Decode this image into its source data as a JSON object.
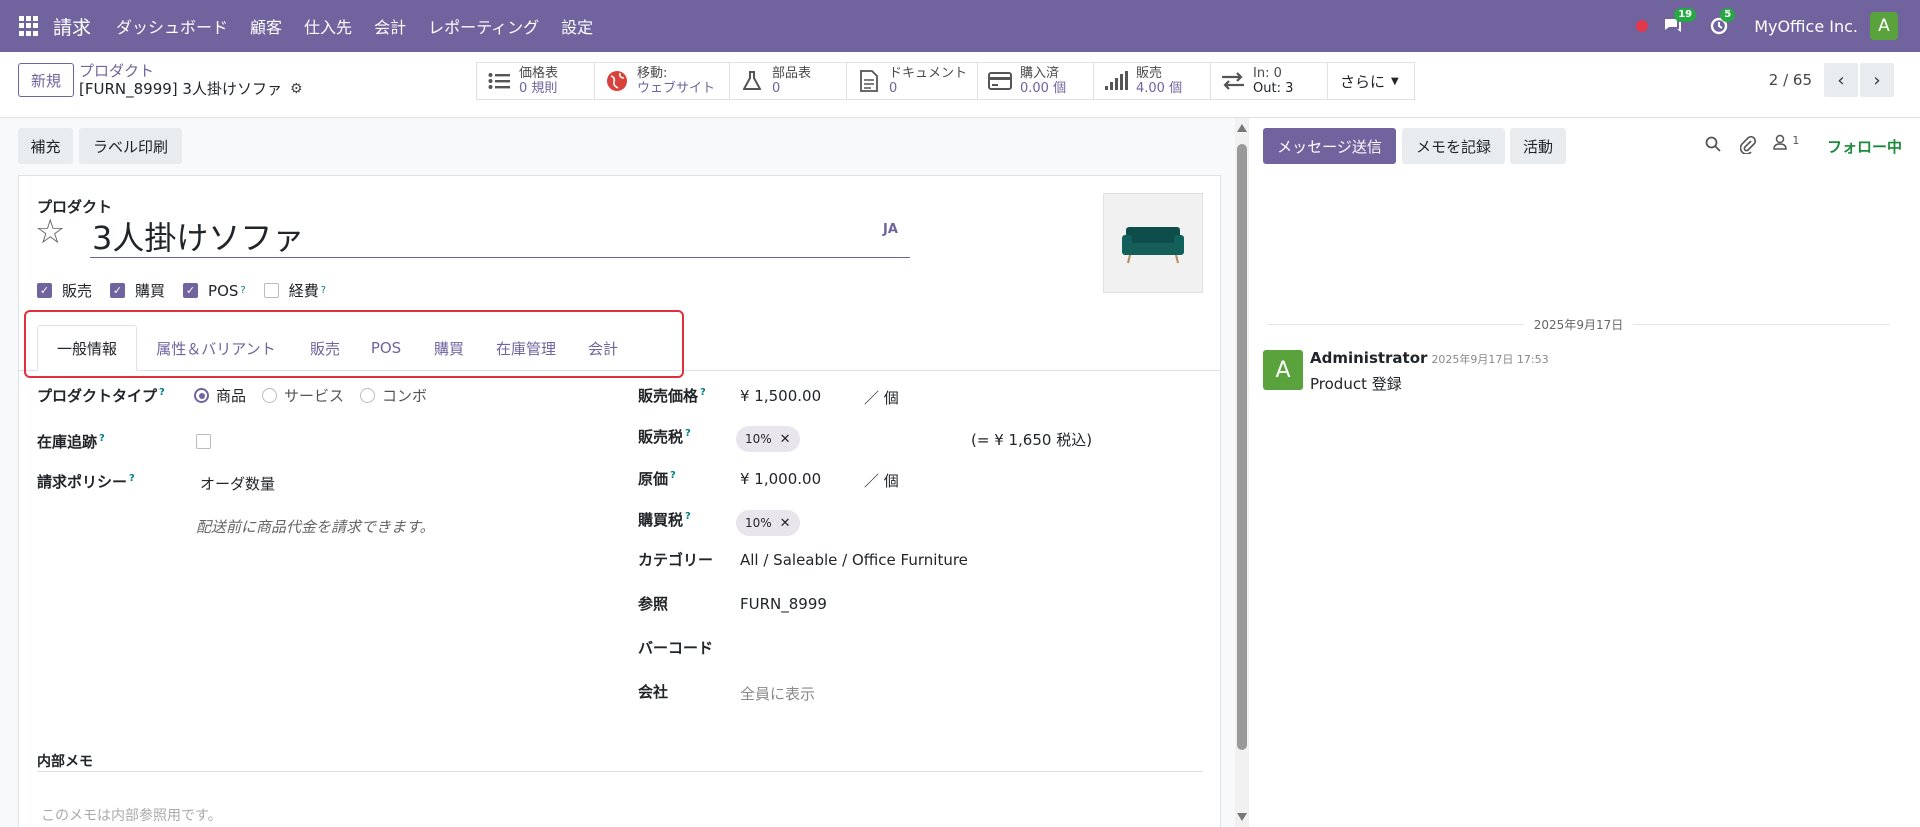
{
  "navbar": {
    "app_name": "請求",
    "menu": [
      "ダッシュボード",
      "顧客",
      "仕入先",
      "会計",
      "レポーティング",
      "設定"
    ],
    "messages_count": "19",
    "activities_count": "5",
    "company": "MyOffice Inc.",
    "user_initial": "A"
  },
  "control": {
    "new_label": "新規",
    "breadcrumb_parent": "プロダクト",
    "breadcrumb_current": "[FURN_8999] 3人掛けソファ",
    "smart_buttons": [
      {
        "label": "価格表",
        "value": "0 規則",
        "icon": "list-icon"
      },
      {
        "label": "移動:",
        "value": "ウェブサイト",
        "icon": "globe-icon"
      },
      {
        "label": "部品表",
        "value": "0",
        "icon": "flask-icon"
      },
      {
        "label": "ドキュメント",
        "value": "0",
        "icon": "document-icon"
      },
      {
        "label": "購入済",
        "value": "0.00 個",
        "icon": "credit-card-icon"
      },
      {
        "label": "販売",
        "value": "4.00 個",
        "icon": "bar-chart-icon"
      },
      {
        "label": "In: 0",
        "value": "Out: 3",
        "icon": "exchange-icon"
      }
    ],
    "more_label": "さらに",
    "pager": "2 / 65"
  },
  "statusbar": {
    "replenish": "補充",
    "print_labels": "ラベル印刷"
  },
  "product": {
    "section_label": "プロダクト",
    "name": "3人掛けソファ",
    "lang": "JA",
    "flags": [
      {
        "label": "販売",
        "checked": true,
        "help": false
      },
      {
        "label": "購買",
        "checked": true,
        "help": false
      },
      {
        "label": "POS",
        "checked": true,
        "help": true
      },
      {
        "label": "経費",
        "checked": false,
        "help": true
      }
    ]
  },
  "tabs": [
    "一般情報",
    "属性＆バリアント",
    "販売",
    "POS",
    "購買",
    "在庫管理",
    "会計"
  ],
  "general": {
    "product_type_label": "プロダクトタイプ",
    "product_type_options": [
      "商品",
      "サービス",
      "コンボ"
    ],
    "product_type_selected": "商品",
    "tracking_label": "在庫追跡",
    "invoice_policy_label": "請求ポリシー",
    "invoice_policy_value": "オーダ数量",
    "invoice_policy_hint": "配送前に商品代金を請求できます。",
    "sales_price_label": "販売価格",
    "sales_price_value": "¥ 1,500.00",
    "sales_price_uom": "／ 個",
    "sales_tax_label": "販売税",
    "sales_tax_tag": "10%",
    "sales_tax_incl": "(= ¥ 1,650 税込)",
    "cost_label": "原価",
    "cost_value": "¥ 1,000.00",
    "cost_uom": "／ 個",
    "purchase_tax_label": "購買税",
    "purchase_tax_tag": "10%",
    "category_label": "カテゴリー",
    "category_value": "All / Saleable / Office Furniture",
    "reference_label": "参照",
    "reference_value": "FURN_8999",
    "barcode_label": "バーコード",
    "company_label": "会社",
    "company_placeholder": "全員に表示",
    "internal_notes_label": "内部メモ",
    "internal_notes_placeholder": "このメモは内部参照用です。"
  },
  "chatter": {
    "send_message": "メッセージ送信",
    "log_note": "メモを記録",
    "activities": "活動",
    "followers_count": "1",
    "follow_status": "フォロー中",
    "date_separator": "2025年9月17日",
    "message": {
      "author": "Administrator",
      "time": "2025年9月17日 17:53",
      "body": "Product 登録",
      "avatar_initial": "A"
    }
  },
  "colors": {
    "brand": "#71639e",
    "highlight": "#e0303c",
    "avatar": "#5aa33c",
    "follow": "#1b8a3b"
  }
}
